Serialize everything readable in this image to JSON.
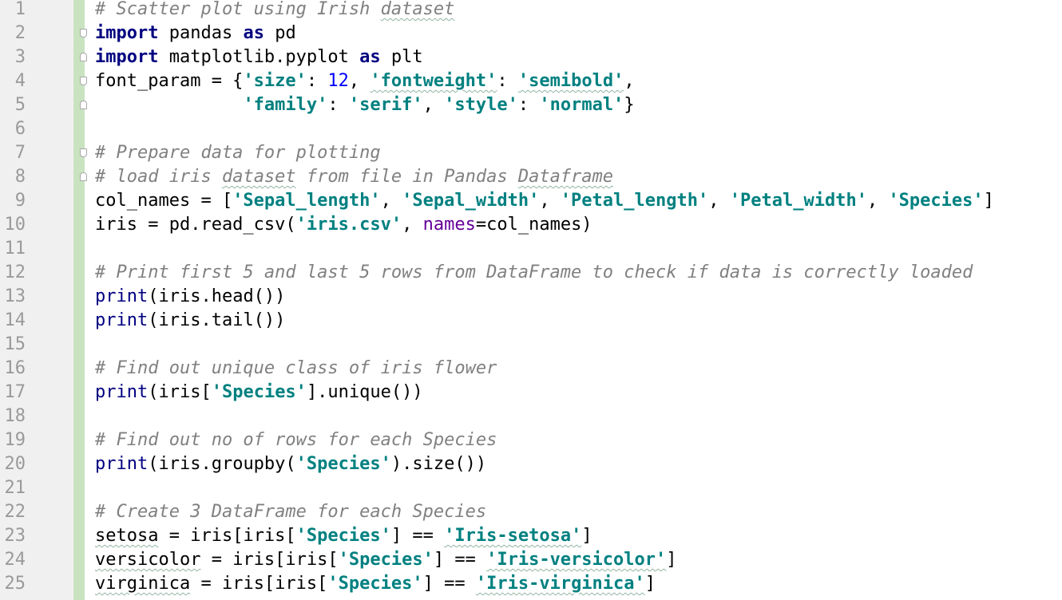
{
  "editor": {
    "line_numbers": [
      "1",
      "2",
      "3",
      "4",
      "5",
      "6",
      "7",
      "8",
      "9",
      "10",
      "11",
      "12",
      "13",
      "14",
      "15",
      "16",
      "17",
      "18",
      "19",
      "20",
      "21",
      "22",
      "23",
      "24",
      "25"
    ],
    "lines": [
      [
        {
          "t": "c",
          "v": "# Scatter plot using Irish dataset"
        }
      ],
      [
        {
          "t": "k",
          "v": "import"
        },
        {
          "t": "t",
          "v": " pandas "
        },
        {
          "t": "k",
          "v": "as"
        },
        {
          "t": "t",
          "v": " pd"
        }
      ],
      [
        {
          "t": "k",
          "v": "import"
        },
        {
          "t": "t",
          "v": " matplotlib.pyplot "
        },
        {
          "t": "k",
          "v": "as"
        },
        {
          "t": "t",
          "v": " plt"
        }
      ],
      [
        {
          "t": "t",
          "v": "font_param = {"
        },
        {
          "t": "s",
          "v": "'size'"
        },
        {
          "t": "t",
          "v": ": "
        },
        {
          "t": "n",
          "v": "12"
        },
        {
          "t": "t",
          "v": ", "
        },
        {
          "t": "s",
          "v": "'fontweight'"
        },
        {
          "t": "t",
          "v": ": "
        },
        {
          "t": "s",
          "v": "'semibold'"
        },
        {
          "t": "t",
          "v": ","
        }
      ],
      [
        {
          "t": "t",
          "v": "              "
        },
        {
          "t": "s",
          "v": "'family'"
        },
        {
          "t": "t",
          "v": ": "
        },
        {
          "t": "s",
          "v": "'serif'"
        },
        {
          "t": "t",
          "v": ", "
        },
        {
          "t": "s",
          "v": "'style'"
        },
        {
          "t": "t",
          "v": ": "
        },
        {
          "t": "s",
          "v": "'normal'"
        },
        {
          "t": "t",
          "v": "}"
        }
      ],
      [],
      [
        {
          "t": "c",
          "v": "# Prepare data for plotting"
        }
      ],
      [
        {
          "t": "c",
          "v": "# load iris dataset from file in Pandas Dataframe"
        }
      ],
      [
        {
          "t": "t",
          "v": "col_names = ["
        },
        {
          "t": "s",
          "v": "'Sepal_length'"
        },
        {
          "t": "t",
          "v": ", "
        },
        {
          "t": "s",
          "v": "'Sepal_width'"
        },
        {
          "t": "t",
          "v": ", "
        },
        {
          "t": "s",
          "v": "'Petal_length'"
        },
        {
          "t": "t",
          "v": ", "
        },
        {
          "t": "s",
          "v": "'Petal_width'"
        },
        {
          "t": "t",
          "v": ", "
        },
        {
          "t": "s",
          "v": "'Species'"
        },
        {
          "t": "t",
          "v": "]"
        }
      ],
      [
        {
          "t": "t",
          "v": "iris = pd.read_csv("
        },
        {
          "t": "s",
          "v": "'iris.csv'"
        },
        {
          "t": "t",
          "v": ", "
        },
        {
          "t": "p",
          "v": "names"
        },
        {
          "t": "t",
          "v": "=col_names)"
        }
      ],
      [],
      [
        {
          "t": "c",
          "v": "# Print first 5 and last 5 rows from DataFrame to check if data is correctly loaded"
        }
      ],
      [
        {
          "t": "b",
          "v": "print"
        },
        {
          "t": "t",
          "v": "(iris.head())"
        }
      ],
      [
        {
          "t": "b",
          "v": "print"
        },
        {
          "t": "t",
          "v": "(iris.tail())"
        }
      ],
      [],
      [
        {
          "t": "c",
          "v": "# Find out unique class of iris flower"
        }
      ],
      [
        {
          "t": "b",
          "v": "print"
        },
        {
          "t": "t",
          "v": "(iris["
        },
        {
          "t": "s",
          "v": "'Species'"
        },
        {
          "t": "t",
          "v": "].unique())"
        }
      ],
      [],
      [
        {
          "t": "c",
          "v": "# Find out no of rows for each Species"
        }
      ],
      [
        {
          "t": "b",
          "v": "print"
        },
        {
          "t": "t",
          "v": "(iris.groupby("
        },
        {
          "t": "s",
          "v": "'Species'"
        },
        {
          "t": "t",
          "v": ").size())"
        }
      ],
      [],
      [
        {
          "t": "c",
          "v": "# Create 3 DataFrame for each Species"
        }
      ],
      [
        {
          "t": "t",
          "v": "setosa = iris[iris["
        },
        {
          "t": "s",
          "v": "'Species'"
        },
        {
          "t": "t",
          "v": "] == "
        },
        {
          "t": "s",
          "v": "'Iris-setosa'"
        },
        {
          "t": "t",
          "v": "]"
        }
      ],
      [
        {
          "t": "t",
          "v": "versicolor = iris[iris["
        },
        {
          "t": "s",
          "v": "'Species'"
        },
        {
          "t": "t",
          "v": "] == "
        },
        {
          "t": "s",
          "v": "'Iris-versicolor'"
        },
        {
          "t": "t",
          "v": "]"
        }
      ],
      [
        {
          "t": "t",
          "v": "virginica = iris[iris["
        },
        {
          "t": "s",
          "v": "'Species'"
        },
        {
          "t": "t",
          "v": "] == "
        },
        {
          "t": "s",
          "v": "'Iris-virginica'"
        },
        {
          "t": "t",
          "v": "]"
        }
      ]
    ],
    "fold_markers": {
      "2": "start",
      "3": "end",
      "4": "start",
      "5": "end",
      "7": "start",
      "8": "end"
    },
    "colors": {
      "comment": "#808080",
      "keyword": "#000080",
      "string": "#008080",
      "number": "#0000ff",
      "builtin": "#000080",
      "param": "#660099",
      "gutter_bg": "#f0f0f0",
      "change_bar": "#c9e3c1",
      "line_number": "#9a9a9a"
    }
  }
}
